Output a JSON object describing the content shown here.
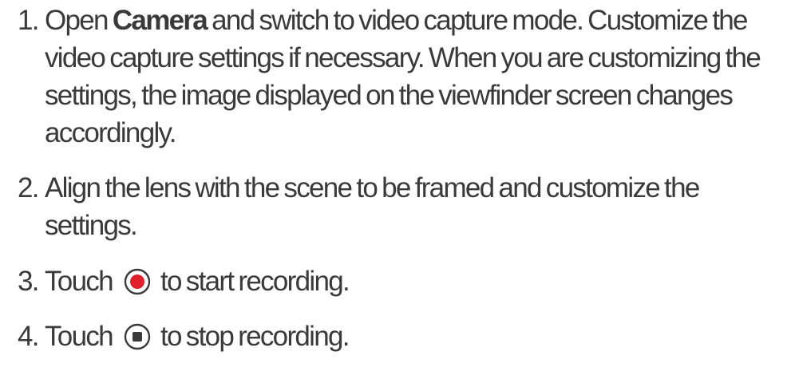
{
  "steps": [
    {
      "number": "1.",
      "text_before": "Open",
      "bold": "Camera",
      "text_after": "and switch to video capture mode. Customize the video capture settings if necessary. When you are customizing the settings, the image displayed on the viewfinder screen changes accordingly."
    },
    {
      "number": "2.",
      "text": "Align the lens with the scene to be framed and customize the settings."
    },
    {
      "number": "3.",
      "text_before": "Touch",
      "icon": "record-button-icon",
      "text_after": "to start recording."
    },
    {
      "number": "4.",
      "text_before": "Touch",
      "icon": "stop-button-icon",
      "text_after": "to stop recording."
    }
  ],
  "colors": {
    "text": "#3a3a3a",
    "record_red": "#e0202a",
    "icon_outline": "#3a3a3a"
  }
}
